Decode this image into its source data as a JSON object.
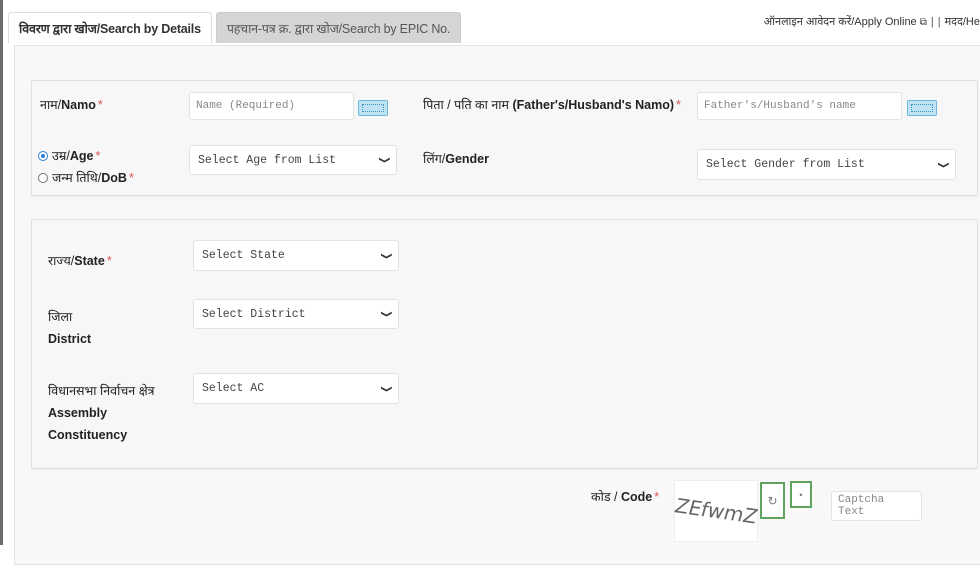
{
  "tabs": [
    {
      "label": "विवरण द्वारा खोज/Search by Details",
      "active": true
    },
    {
      "label": "पहचान-पत्र क्र. द्वारा खोज/Search by EPIC No.",
      "active": false
    }
  ],
  "top_links": {
    "apply_online": "ऑनलाइन आवेदन करें/Apply Online",
    "separator": "|",
    "help": "मदद/He"
  },
  "personal": {
    "name_label_hi": "नाम/",
    "name_label_en": "Namo",
    "name_placeholder": "Name (Required)",
    "father_label_hi": "पिता / पति का नाम ",
    "father_label_en": "(Father's/Husband's Namo)",
    "father_placeholder": "Father's/Husband's name",
    "age_label_hi": "उम्र/",
    "age_label_en": "Age",
    "age_selected": true,
    "dob_label_hi": "जन्म तिथि/",
    "dob_label_en": "DoB",
    "age_select_value": "Select Age from List",
    "gender_label_hi": "लिंग/",
    "gender_label_en": "Gender",
    "gender_select_value": "Select Gender from List"
  },
  "location": {
    "state_label_hi": "राज्य/",
    "state_label_en": "State",
    "state_select_value": "Select State",
    "district_label_hi": "जिला",
    "district_label_en": "District",
    "district_select_value": "Select District",
    "ac_label_hi": "विधानसभा निर्वाचन क्षेत्र",
    "ac_label_en_1": "Assembly",
    "ac_label_en_2": "Constituency",
    "ac_select_value": "Select AC"
  },
  "captcha": {
    "label_hi": "कोड / ",
    "label_en": "Code",
    "image_text": "ZEfwmZ",
    "refresh_icon": "↻",
    "audio_icon": "•",
    "input_placeholder": "Captcha Text"
  },
  "required_mark": "*",
  "chevron": "⌄"
}
